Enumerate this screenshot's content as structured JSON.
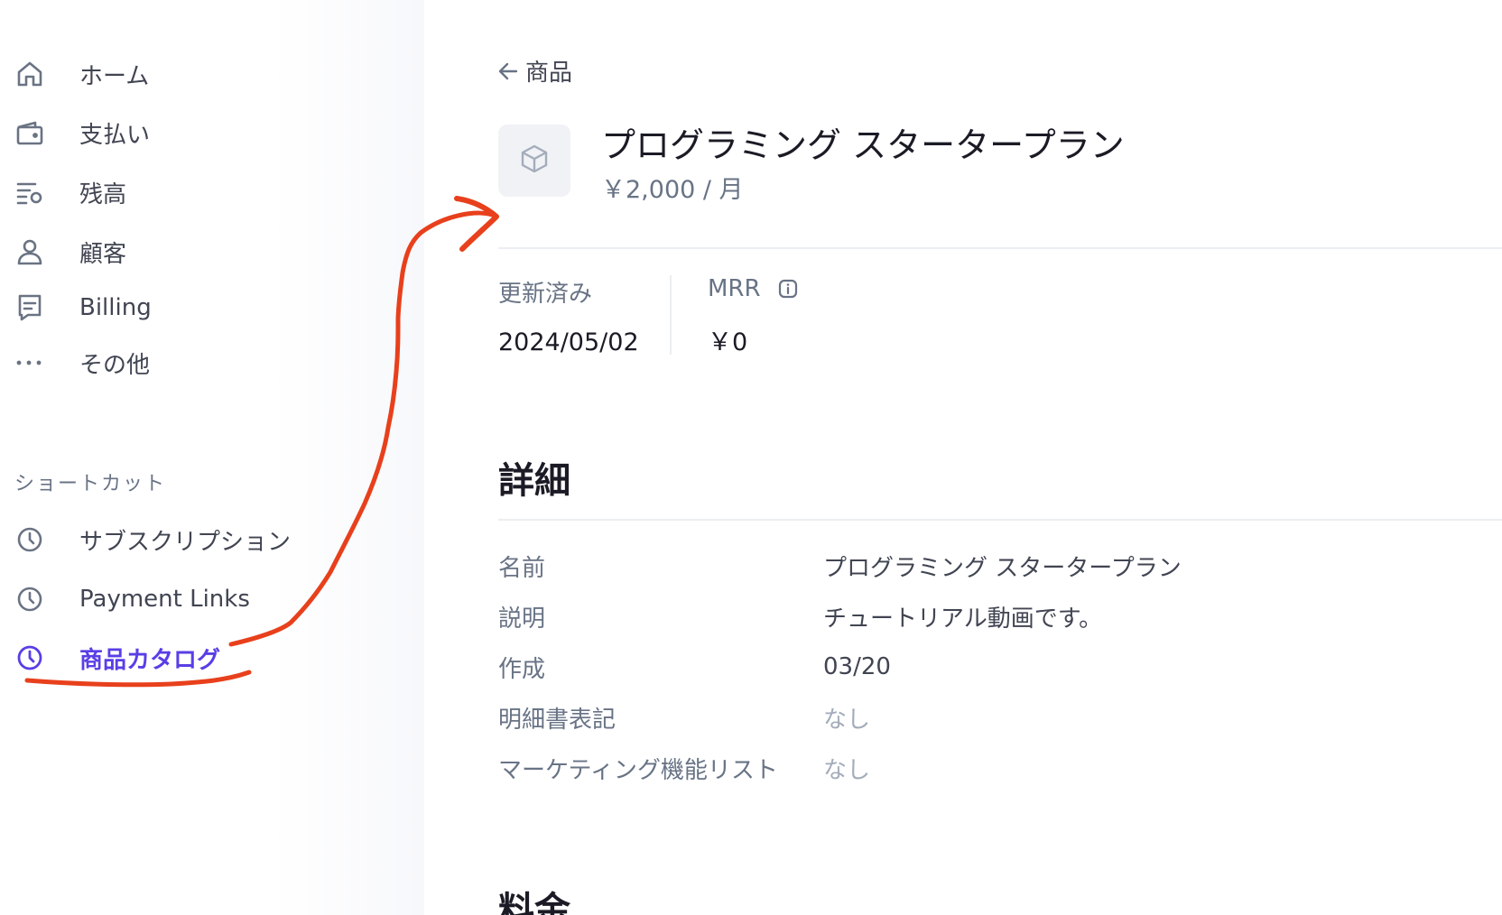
{
  "sidebar": {
    "items": [
      {
        "label": "ホーム",
        "icon": "home-icon"
      },
      {
        "label": "支払い",
        "icon": "wallet-icon"
      },
      {
        "label": "残高",
        "icon": "balance-icon"
      },
      {
        "label": "顧客",
        "icon": "person-icon"
      },
      {
        "label": "Billing",
        "icon": "receipt-icon"
      },
      {
        "label": "その他",
        "icon": "more-icon"
      }
    ],
    "shortcuts_label": "ショートカット",
    "shortcuts": [
      {
        "label": "サブスクリプション",
        "icon": "clock-icon"
      },
      {
        "label": "Payment Links",
        "icon": "clock-icon"
      },
      {
        "label": "商品カタログ",
        "icon": "clock-icon",
        "active": true
      }
    ]
  },
  "main": {
    "back_label": "商品",
    "product": {
      "title": "プログラミング スタータープラン",
      "price": "￥2,000 / 月"
    },
    "stats": [
      {
        "label": "更新済み",
        "value": "2024/05/02"
      },
      {
        "label": "MRR",
        "value": "￥0"
      }
    ],
    "details_title": "詳細",
    "details": [
      {
        "key": "名前",
        "value": "プログラミング スタータープラン"
      },
      {
        "key": "説明",
        "value": "チュートリアル動画です。"
      },
      {
        "key": "作成",
        "value": "03/20"
      },
      {
        "key": "明細書表記",
        "value": "なし"
      },
      {
        "key": "マーケティング機能リスト",
        "value": "なし"
      }
    ],
    "pricing_title": "料金"
  },
  "colors": {
    "accent": "#5a3ee6",
    "annotation": "#e8401c"
  }
}
